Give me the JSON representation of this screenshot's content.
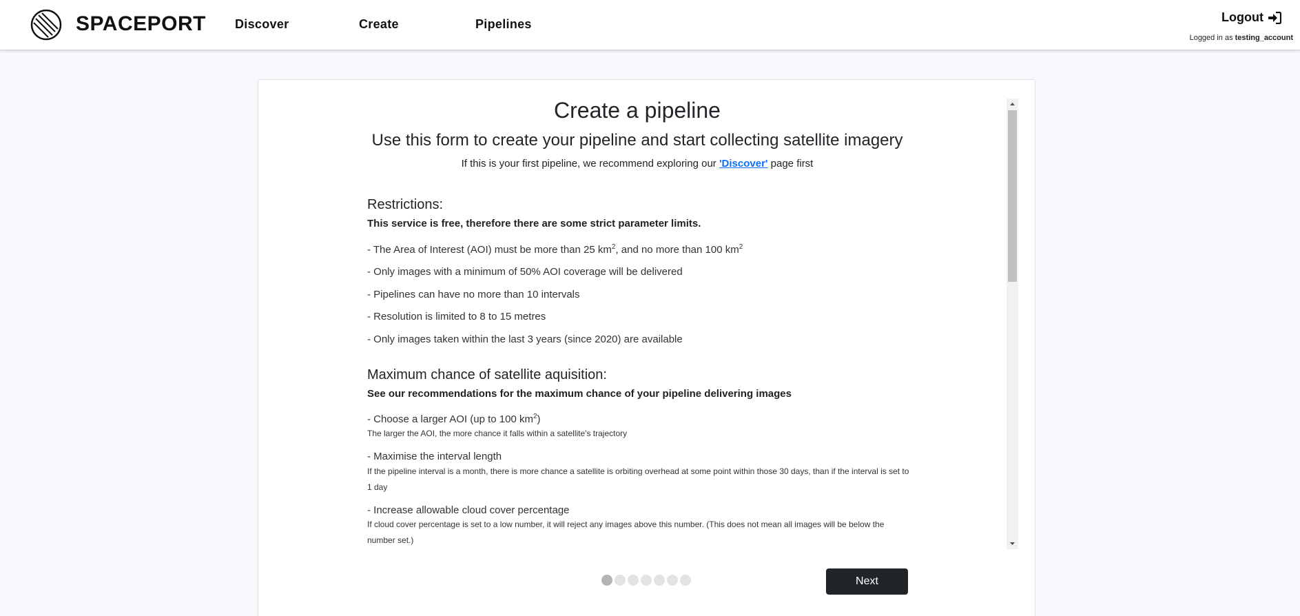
{
  "nav": {
    "brand": "SPACEPORT",
    "links": [
      "Discover",
      "Create",
      "Pipelines"
    ],
    "logout_label": "Logout",
    "logged_in_prefix": "Logged in as",
    "username": "testing_account"
  },
  "form": {
    "title": "Create a pipeline",
    "subtitle": "Use this form to create your pipeline and start collecting satellite imagery",
    "intro_prefix": "If this is your first pipeline, we recommend exploring our ",
    "intro_link": "'Discover'",
    "intro_suffix": " page first",
    "restrictions": {
      "heading": "Restrictions:",
      "subheading": "This service is free, therefore there are some strict parameter limits.",
      "item1_a": "- The Area of Interest (AOI) must be more than 25 km",
      "item1_sup1": "2",
      "item1_b": ", and no more than 100 km",
      "item1_sup2": "2",
      "item2": "- Only images with a minimum of 50% AOI coverage will be delivered",
      "item3": "- Pipelines can have no more than 10 intervals",
      "item4": "- Resolution is limited to 8 to 15 metres",
      "item5": "- Only images taken within the last 3 years (since 2020) are available"
    },
    "acquisition": {
      "heading": "Maximum chance of satellite aquisition:",
      "subheading": "See our recommendations for the maximum chance of your pipeline delivering images",
      "tip1_a": "- Choose a larger AOI (up to 100 km",
      "tip1_sup": "2",
      "tip1_b": ")",
      "tip1_desc": "The larger the AOI, the more chance it falls within a satellite's trajectory",
      "tip2": "- Maximise the interval length",
      "tip2_desc": "If the pipeline interval is a month, there is more chance a satellite is orbiting overhead at some point within those 30 days, than if the interval is set to 1 day",
      "tip3": "- Increase allowable cloud cover percentage",
      "tip3_desc": "If cloud cover percentage is set to a low number, it will reject any images above this number. (This does not mean all images will be below the number set.)"
    },
    "step_count": 7,
    "current_step": 1,
    "next_label": "Next"
  }
}
